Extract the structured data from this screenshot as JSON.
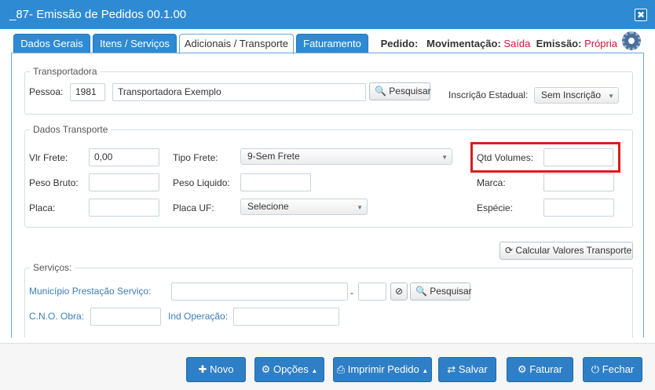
{
  "window": {
    "title": "_87- Emissão de Pedidos 00.1.00",
    "close_icon": "✖"
  },
  "tabs": [
    {
      "label": "Dados Gerais"
    },
    {
      "label": "Itens / Serviços"
    },
    {
      "label": "Adicionais / Transporte"
    },
    {
      "label": "Faturamento"
    }
  ],
  "header_info": {
    "pedido_label": "Pedido:",
    "mov_label": "Movimentação:",
    "mov_value": "Saída",
    "emissao_label": "Emissão:",
    "emissao_value": "Própria"
  },
  "transportadora": {
    "legend": "Transportadora",
    "pessoa_label": "Pessoa:",
    "pessoa_code": "1981",
    "pessoa_name": "Transportadora Exemplo",
    "search_label": "Pesquisar",
    "ie_label": "Inscrição Estadual:",
    "ie_value": "Sem Inscrição"
  },
  "dados_transporte": {
    "legend": "Dados Transporte",
    "vlr_frete_label": "Vlr Frete:",
    "vlr_frete_value": "0,00",
    "tipo_frete_label": "Tipo Frete:",
    "tipo_frete_value": "9-Sem Frete",
    "qtd_volumes_label": "Qtd Volumes:",
    "qtd_volumes_value": "",
    "peso_bruto_label": "Peso Bruto:",
    "peso_liquido_label": "Peso Liquido:",
    "marca_label": "Marca:",
    "placa_label": "Placa:",
    "placa_uf_label": "Placa UF:",
    "placa_uf_value": "Selecione",
    "especie_label": "Espécie:"
  },
  "calc_button": {
    "label": "Calcular Valores Transporte"
  },
  "servicos": {
    "legend": "Serviços:",
    "municipio_label": "Município Prestação Serviço:",
    "dash": "-",
    "search_label": "Pesquisar",
    "cno_label": "C.N.O. Obra:",
    "ind_operacao_label": "Ind Operação:"
  },
  "footer": {
    "novo": "Novo",
    "opcoes": "Opções",
    "imprimir": "Imprimir Pedido",
    "salvar": "Salvar",
    "faturar": "Faturar",
    "fechar": "Fechar"
  },
  "colors": {
    "primary": "#2e8bd3",
    "alert": "#d3143b",
    "highlight": "#d81e1e"
  }
}
